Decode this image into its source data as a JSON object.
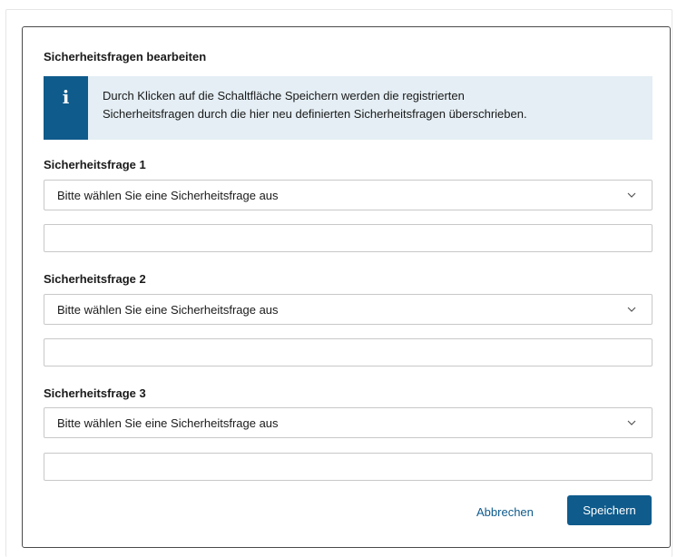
{
  "dialog": {
    "title": "Sicherheitsfragen bearbeiten",
    "info": {
      "icon": "info-icon",
      "line1": "Durch Klicken auf die Schaltfläche Speichern werden die registrierten",
      "line2": "Sicherheitsfragen durch die hier neu definierten Sicherheitsfragen überschrieben."
    },
    "questions": [
      {
        "label": "Sicherheitsfrage 1",
        "select_value": "Bitte wählen Sie eine Sicherheitsfrage aus",
        "answer_value": ""
      },
      {
        "label": "Sicherheitsfrage 2",
        "select_value": "Bitte wählen Sie eine Sicherheitsfrage aus",
        "answer_value": ""
      },
      {
        "label": "Sicherheitsfrage 3",
        "select_value": "Bitte wählen Sie eine Sicherheitsfrage aus",
        "answer_value": ""
      }
    ],
    "buttons": {
      "cancel_label": "Abbrechen",
      "save_label": "Speichern"
    }
  },
  "colors": {
    "accent": "#0f5b8c",
    "info_background": "#e4eef4",
    "border": "#c8c8c8"
  }
}
